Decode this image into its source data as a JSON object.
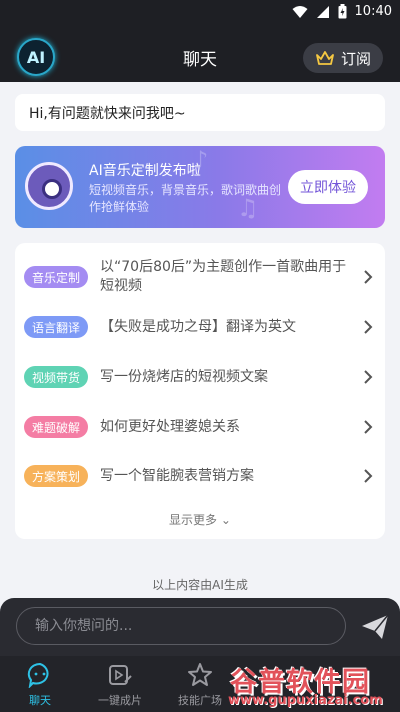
{
  "status_bar": {
    "time": "10:40"
  },
  "header": {
    "logo_text": "AI",
    "title": "聊天",
    "subscribe_label": "订阅"
  },
  "greeting": "Hi,有问题就快来问我吧~",
  "promo": {
    "title": "AI音乐定制发布啦",
    "description": "短视频音乐，背景音乐，歌词歌曲创作抢鲜体验",
    "button": "立即体验"
  },
  "suggestions": [
    {
      "tag": "音乐定制",
      "text": "以“70后80后”为主题创作一首歌曲用于短视频",
      "color": "#a48cf2"
    },
    {
      "tag": "语言翻译",
      "text": "【失败是成功之母】翻译为英文",
      "color": "#7e9af6"
    },
    {
      "tag": "视频带货",
      "text": "写一份烧烤店的短视频文案",
      "color": "#5fd3b4"
    },
    {
      "tag": "难题破解",
      "text": "如何更好处理婆媳关系",
      "color": "#f47da4"
    },
    {
      "tag": "方案策划",
      "text": "写一个智能腕表营销方案",
      "color": "#f7b25a"
    }
  ],
  "show_more": "显示更多",
  "ai_note": "以上内容由AI生成",
  "input": {
    "placeholder": "输入你想问的..."
  },
  "nav": [
    {
      "label": "聊天",
      "icon": "chat-icon",
      "active": true
    },
    {
      "label": "一键成片",
      "icon": "video-icon",
      "active": false
    },
    {
      "label": "技能广场",
      "icon": "star-icon",
      "active": false
    }
  ],
  "watermark": {
    "brand": "谷普软件园",
    "url": "www.gupuxiazai.com"
  },
  "colors": {
    "accent": "#2ec2e6",
    "dark_bg": "#1e1f24",
    "promo_button_text": "#7355d8"
  }
}
